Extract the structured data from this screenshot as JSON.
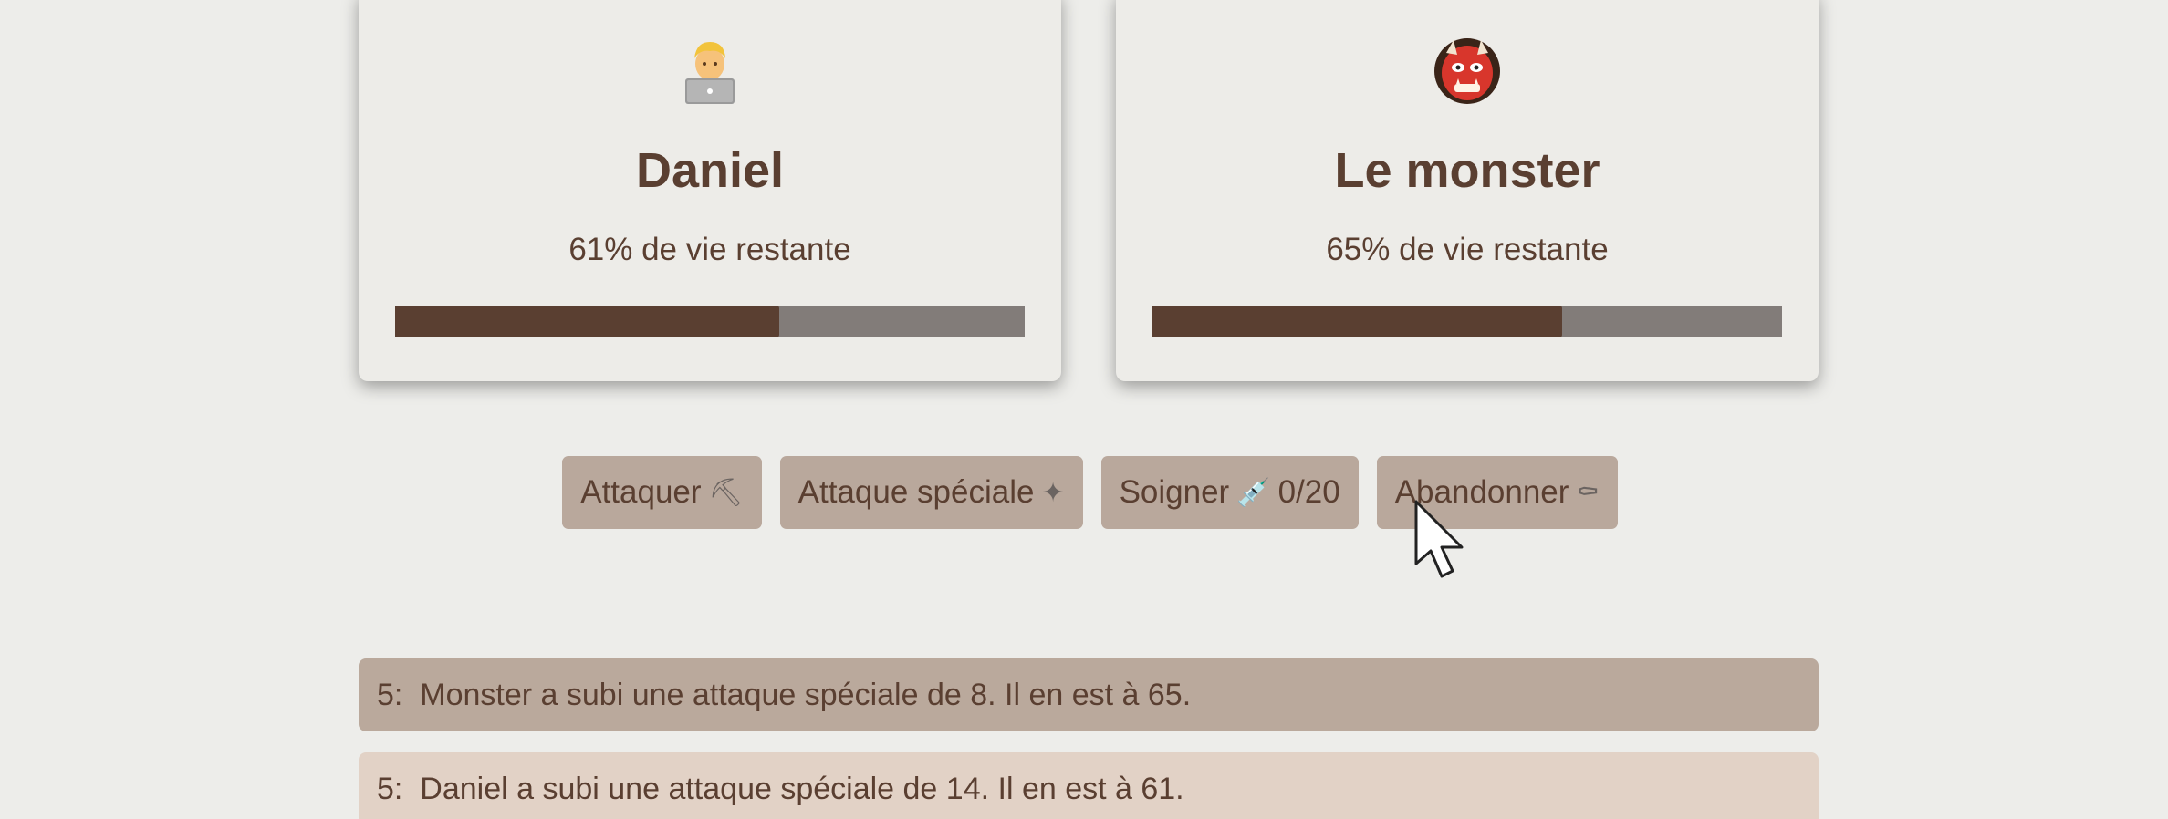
{
  "player": {
    "name": "Daniel",
    "hp_text": "61% de vie restante",
    "hp_fraction": 0.61,
    "avatar_icon": "man-technologist-laptop-icon"
  },
  "monster": {
    "name": "Le monster",
    "hp_text": "65% de vie restante",
    "hp_fraction": 0.65,
    "avatar_icon": "ogre-mask-icon"
  },
  "actions": {
    "attack": {
      "label": "Attaquer",
      "icon": "⛏"
    },
    "special": {
      "label": "Attaque spéciale",
      "icon": "✦"
    },
    "heal": {
      "label": "Soigner",
      "icon": "💉",
      "counter": "0/20"
    },
    "surrender": {
      "label": "Abandonner",
      "icon": "⚰"
    }
  },
  "log": [
    {
      "turn": "5:",
      "text": "Monster a subi une attaque spéciale de 8. Il en est à 65."
    },
    {
      "turn": "5:",
      "text": "Daniel a subi une attaque spéciale de 14. Il en est à 61."
    }
  ],
  "colors": {
    "background": "#ededea",
    "text": "#5a3f31",
    "bar_fill": "#5a3f31",
    "bar_track": "#827c79",
    "button_bg": "#b9a89c",
    "log_monster_bg": "#baa99c",
    "log_player_bg": "#e2d2c6"
  }
}
